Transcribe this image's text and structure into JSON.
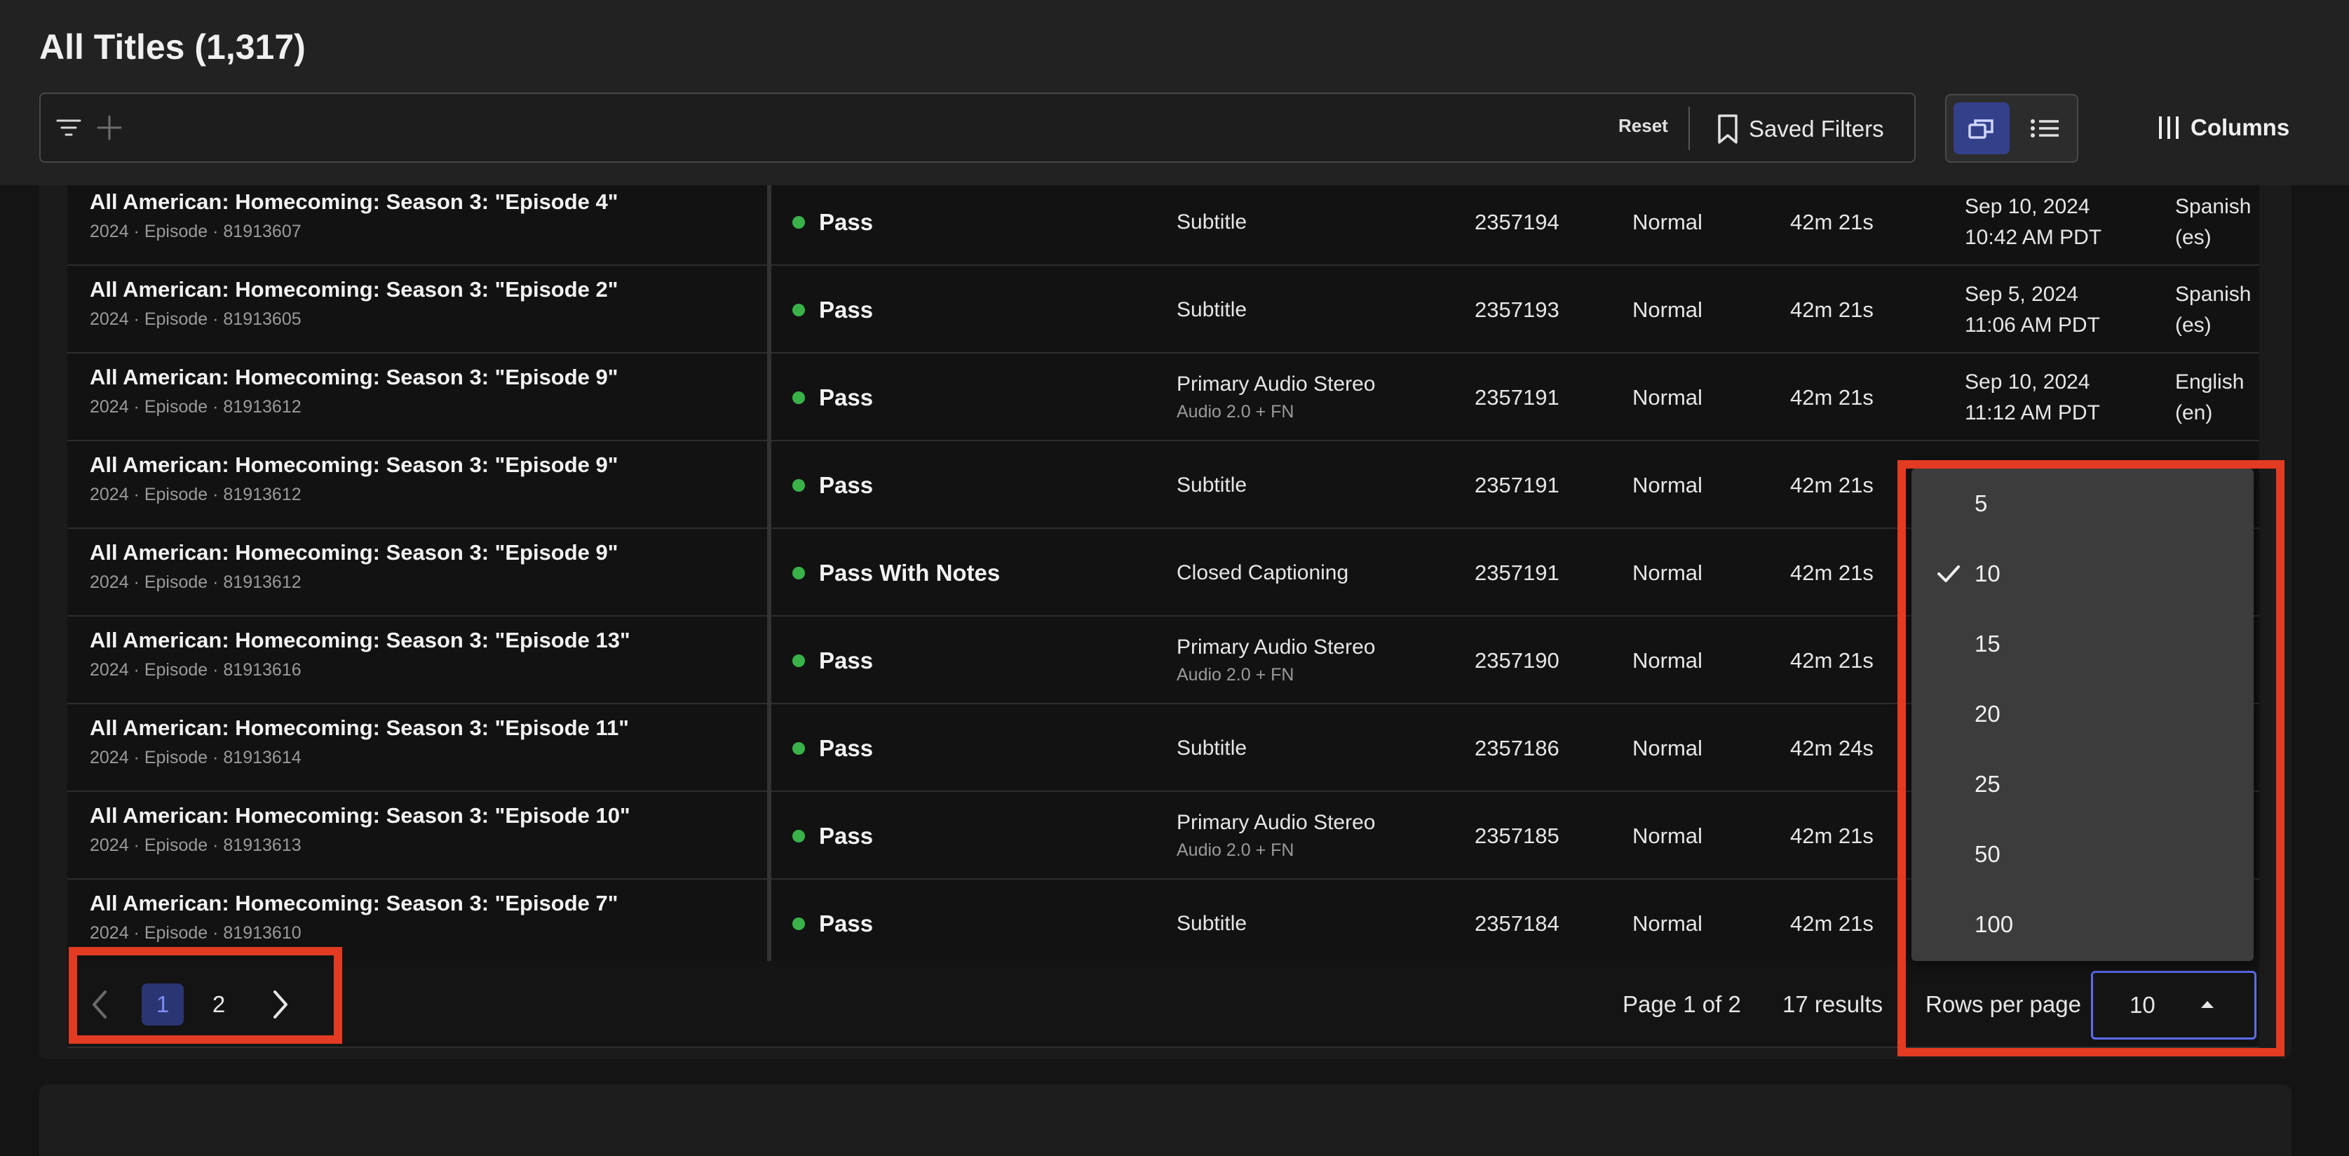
{
  "header": {
    "title": "All Titles (1,317)",
    "reset_label": "Reset",
    "saved_filters_label": "Saved Filters",
    "columns_label": "Columns"
  },
  "rows": [
    {
      "title": "All American: Homecoming: Season 3: \"Episode 4\"",
      "sub": "2024 · Episode · 81913607",
      "status": "Pass",
      "type": "Subtitle",
      "type_sub": "",
      "id": "2357194",
      "priority": "Normal",
      "duration": "42m 21s",
      "date": "Sep 10, 2024",
      "time": "10:42 AM PDT",
      "lang": "Spanish",
      "lang_code": "(es)"
    },
    {
      "title": "All American: Homecoming: Season 3: \"Episode 2\"",
      "sub": "2024 · Episode · 81913605",
      "status": "Pass",
      "type": "Subtitle",
      "type_sub": "",
      "id": "2357193",
      "priority": "Normal",
      "duration": "42m 21s",
      "date": "Sep 5, 2024",
      "time": "11:06 AM PDT",
      "lang": "Spanish",
      "lang_code": "(es)"
    },
    {
      "title": "All American: Homecoming: Season 3: \"Episode 9\"",
      "sub": "2024 · Episode · 81913612",
      "status": "Pass",
      "type": "Primary Audio Stereo",
      "type_sub": "Audio 2.0 + FN",
      "id": "2357191",
      "priority": "Normal",
      "duration": "42m 21s",
      "date": "Sep 10, 2024",
      "time": "11:12 AM PDT",
      "lang": "English",
      "lang_code": "(en)"
    },
    {
      "title": "All American: Homecoming: Season 3: \"Episode 9\"",
      "sub": "2024 · Episode · 81913612",
      "status": "Pass",
      "type": "Subtitle",
      "type_sub": "",
      "id": "2357191",
      "priority": "Normal",
      "duration": "42m 21s",
      "date": "",
      "time": "",
      "lang": "",
      "lang_code": ""
    },
    {
      "title": "All American: Homecoming: Season 3: \"Episode 9\"",
      "sub": "2024 · Episode · 81913612",
      "status": "Pass With Notes",
      "type": "Closed Captioning",
      "type_sub": "",
      "id": "2357191",
      "priority": "Normal",
      "duration": "42m 21s",
      "date": "",
      "time": "",
      "lang": "",
      "lang_code": ""
    },
    {
      "title": "All American: Homecoming: Season 3: \"Episode 13\"",
      "sub": "2024 · Episode · 81913616",
      "status": "Pass",
      "type": "Primary Audio Stereo",
      "type_sub": "Audio 2.0 + FN",
      "id": "2357190",
      "priority": "Normal",
      "duration": "42m 21s",
      "date": "",
      "time": "",
      "lang": "",
      "lang_code": ""
    },
    {
      "title": "All American: Homecoming: Season 3: \"Episode 11\"",
      "sub": "2024 · Episode · 81913614",
      "status": "Pass",
      "type": "Subtitle",
      "type_sub": "",
      "id": "2357186",
      "priority": "Normal",
      "duration": "42m 24s",
      "date": "",
      "time": "",
      "lang": "",
      "lang_code": ""
    },
    {
      "title": "All American: Homecoming: Season 3: \"Episode 10\"",
      "sub": "2024 · Episode · 81913613",
      "status": "Pass",
      "type": "Primary Audio Stereo",
      "type_sub": "Audio 2.0 + FN",
      "id": "2357185",
      "priority": "Normal",
      "duration": "42m 21s",
      "date": "",
      "time": "",
      "lang": "",
      "lang_code": ""
    },
    {
      "title": "All American: Homecoming: Season 3: \"Episode 7\"",
      "sub": "2024 · Episode · 81913610",
      "status": "Pass",
      "type": "Subtitle",
      "type_sub": "",
      "id": "2357184",
      "priority": "Normal",
      "duration": "42m 21s",
      "date": "",
      "time": "",
      "lang": "",
      "lang_code": ""
    }
  ],
  "pagination": {
    "pages": [
      "1",
      "2"
    ],
    "current_page": "1",
    "page_info": "Page 1 of 2",
    "results": "17 results",
    "rows_per_page_label": "Rows per page",
    "rows_per_page_value": "10",
    "options": [
      "5",
      "10",
      "15",
      "20",
      "25",
      "50",
      "100"
    ],
    "selected_option": "10"
  },
  "colors": {
    "status_pass": "#39b24a",
    "accent": "#5b6cf0",
    "annotation": "#e23b22"
  },
  "icons": [
    "filter-icon",
    "plus-icon",
    "bookmark-icon",
    "card-view-icon",
    "list-view-icon",
    "columns-icon",
    "chevron-left-icon",
    "chevron-right-icon",
    "caret-up-icon",
    "check-icon"
  ]
}
